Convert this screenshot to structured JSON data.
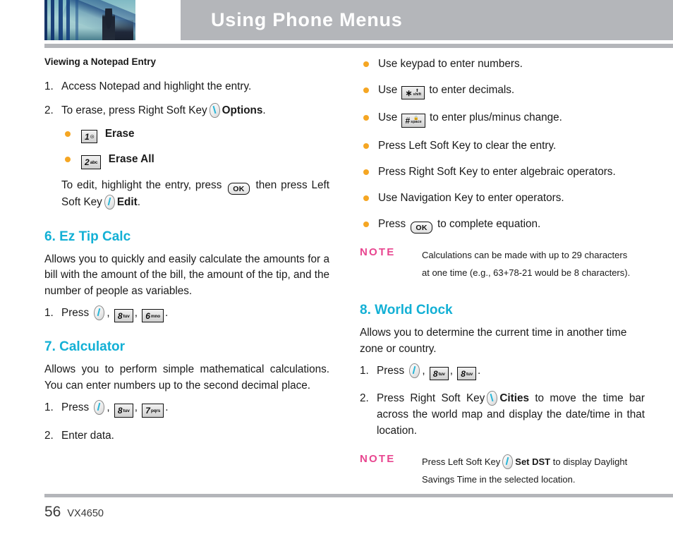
{
  "header": {
    "title": "Using Phone Menus"
  },
  "left_column": {
    "subheading": "Viewing a Notepad Entry",
    "step1": {
      "num": "1.",
      "text": "Access Notepad and highlight the entry."
    },
    "step2": {
      "num": "2.",
      "text_before": "To erase, press Right Soft Key",
      "softkey": "right-soft-key",
      "bold_label": "Options",
      "text_after": "."
    },
    "erase_bullets": [
      {
        "key_num": "1",
        "key_sub": "☉",
        "label": "Erase"
      },
      {
        "key_num": "2",
        "key_sub": "abc",
        "label": "Erase All"
      }
    ],
    "edit_note": {
      "before": "To edit, highlight the entry, press",
      "ok_key": "OK",
      "middle": "then press Left Soft Key",
      "bold_label": "Edit",
      "after": "."
    },
    "section6": {
      "title": "6. Ez Tip Calc",
      "body": "Allows you to quickly and easily calculate the amounts for a bill with the amount of the bill, the amount of the tip, and the number of people as variables.",
      "step_num": "1.",
      "step_text": "Press",
      "keys": [
        {
          "type": "softkey",
          "variant": "left"
        },
        {
          "type": "keybox",
          "num": "8",
          "sub": "tuv"
        },
        {
          "type": "keybox",
          "num": "6",
          "sub": "mno"
        }
      ],
      "step_end": "."
    },
    "section7": {
      "title": "7. Calculator",
      "body": "Allows you to perform simple mathematical calculations. You can enter numbers up to the second decimal place.",
      "step1_num": "1.",
      "step1_text": "Press",
      "step1_keys": [
        {
          "type": "softkey",
          "variant": "left"
        },
        {
          "type": "keybox",
          "num": "8",
          "sub": "tuv"
        },
        {
          "type": "keybox",
          "num": "7",
          "sub": "pqrs"
        }
      ],
      "step1_end": ".",
      "step2_num": "2.",
      "step2_text": "Enter data."
    }
  },
  "right_column": {
    "calc_bullets": [
      {
        "before": "Use keypad to enter numbers.",
        "key": null,
        "after": ""
      },
      {
        "before": "Use",
        "key": {
          "sym": "∗",
          "top": "⬆",
          "bot": "shift"
        },
        "after": "to enter decimals."
      },
      {
        "before": "Use",
        "key": {
          "sym": "#",
          "top": "🔒",
          "bot": "space"
        },
        "after": "to enter plus/minus change."
      },
      {
        "before": "Press Left Soft Key to clear the entry.",
        "key": null,
        "after": ""
      },
      {
        "before": "Press Right Soft Key to enter algebraic operators.",
        "key": null,
        "after": ""
      },
      {
        "before": "Use Navigation Key to enter operators.",
        "key": null,
        "after": ""
      },
      {
        "before": "Press",
        "key": {
          "ok": "OK"
        },
        "after": "to complete equation."
      }
    ],
    "note1": {
      "label": "NOTE",
      "line1": "Calculations can be made with up to 29 characters",
      "line2": "at one time (e.g., 63+78-21 would be 8 characters)."
    },
    "section8": {
      "title": "8. World Clock",
      "body": "Allows you to determine the current time in another time zone or country.",
      "step1_num": "1.",
      "step1_text": "Press",
      "step1_keys": [
        {
          "type": "softkey",
          "variant": "left"
        },
        {
          "type": "keybox",
          "num": "8",
          "sub": "tuv"
        },
        {
          "type": "keybox",
          "num": "8",
          "sub": "tuv"
        }
      ],
      "step1_end": ".",
      "step2_num": "2.",
      "step2_before": "Press Right Soft Key",
      "step2_bold": "Cities",
      "step2_after": "to move the time bar across the world map and display the date/time in that location."
    },
    "note2": {
      "label": "NOTE",
      "line1_before": "Press Left Soft Key",
      "line1_bold": "Set DST",
      "line1_after": "to display Daylight",
      "line2": "Savings Time in the selected location."
    }
  },
  "footer": {
    "page_number": "56",
    "model": "VX4650"
  },
  "colors": {
    "header_bar": "#b4b6ba",
    "section_heading": "#13b0d5",
    "bullet": "#f5a623",
    "note_label": "#e8458f",
    "softkey_slash": "#29b6d8"
  }
}
